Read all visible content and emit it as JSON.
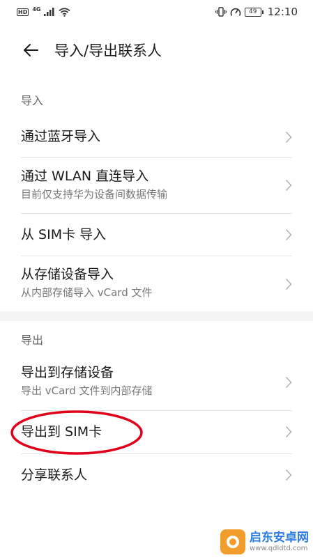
{
  "status_bar": {
    "hd": "HD",
    "network": "4G",
    "battery": "49",
    "time": "12:10"
  },
  "header": {
    "title": "导入/导出联系人"
  },
  "import_section": {
    "header": "导入",
    "items": [
      {
        "title": "通过蓝牙导入",
        "subtitle": ""
      },
      {
        "title": "通过 WLAN 直连导入",
        "subtitle": "目前仅支持华为设备间数据传输"
      },
      {
        "title": "从 SIM卡 导入",
        "subtitle": ""
      },
      {
        "title": "从存储设备导入",
        "subtitle": "从内部存储导入 vCard 文件"
      }
    ]
  },
  "export_section": {
    "header": "导出",
    "items": [
      {
        "title": "导出到存储设备",
        "subtitle": "导出 vCard 文件到内部存储"
      },
      {
        "title": "导出到 SIM卡",
        "subtitle": ""
      },
      {
        "title": "分享联系人",
        "subtitle": ""
      }
    ]
  },
  "watermark": {
    "name": "启东安卓网",
    "url": "www.qdldtd.com"
  },
  "colors": {
    "highlight": "#e0001b",
    "chevron": "#b3b3b3"
  }
}
